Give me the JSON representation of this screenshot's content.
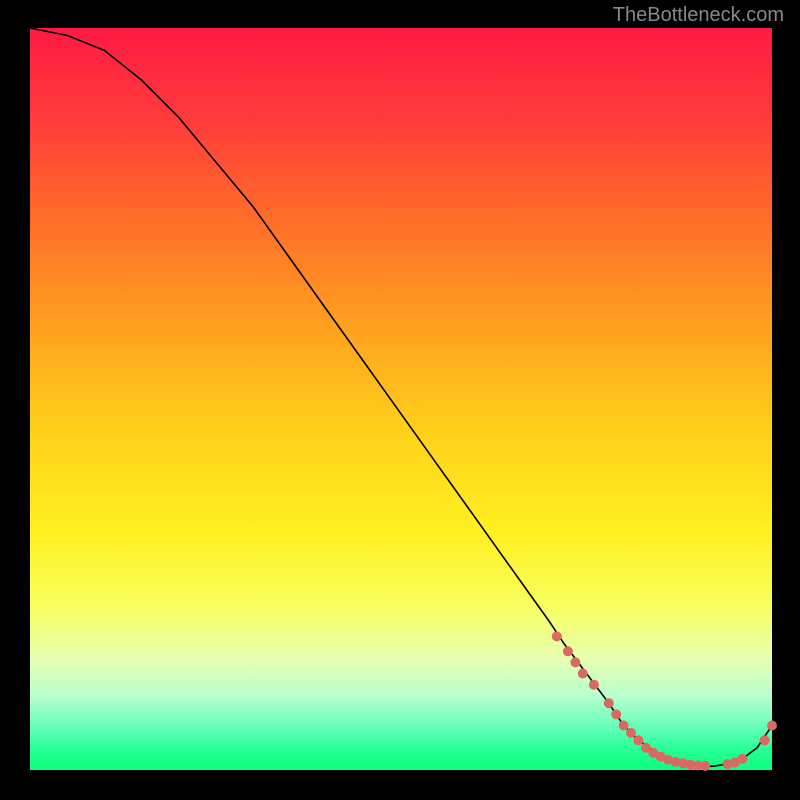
{
  "watermark": "TheBottleneck.com",
  "chart_data": {
    "type": "line",
    "title": "",
    "xlabel": "",
    "ylabel": "",
    "xlim": [
      0,
      100
    ],
    "ylim": [
      0,
      100
    ],
    "curve": {
      "x": [
        0,
        5,
        10,
        15,
        20,
        25,
        30,
        35,
        40,
        45,
        50,
        55,
        60,
        65,
        70,
        72,
        75,
        78,
        80,
        82,
        85,
        88,
        90,
        92,
        94,
        96,
        98,
        100
      ],
      "y": [
        100,
        99,
        97,
        93,
        88,
        82,
        76,
        69,
        62,
        55,
        48,
        41,
        34,
        27,
        20,
        17,
        13,
        9,
        6,
        4,
        2,
        1,
        0.5,
        0.5,
        0.8,
        1.5,
        3,
        6
      ]
    },
    "markers": {
      "x": [
        71,
        72.5,
        73.5,
        74.5,
        76,
        78,
        79,
        80,
        81,
        82,
        83,
        84,
        85,
        86,
        87,
        88,
        89,
        90,
        91,
        94,
        95,
        96,
        99,
        100
      ],
      "y": [
        18,
        16,
        14.5,
        13,
        11.5,
        9,
        7.5,
        6,
        5,
        4,
        3,
        2.3,
        1.8,
        1.4,
        1.1,
        0.9,
        0.7,
        0.6,
        0.55,
        0.8,
        1.0,
        1.5,
        4,
        6
      ],
      "color": "#d86a60"
    },
    "gradient_background": true
  }
}
